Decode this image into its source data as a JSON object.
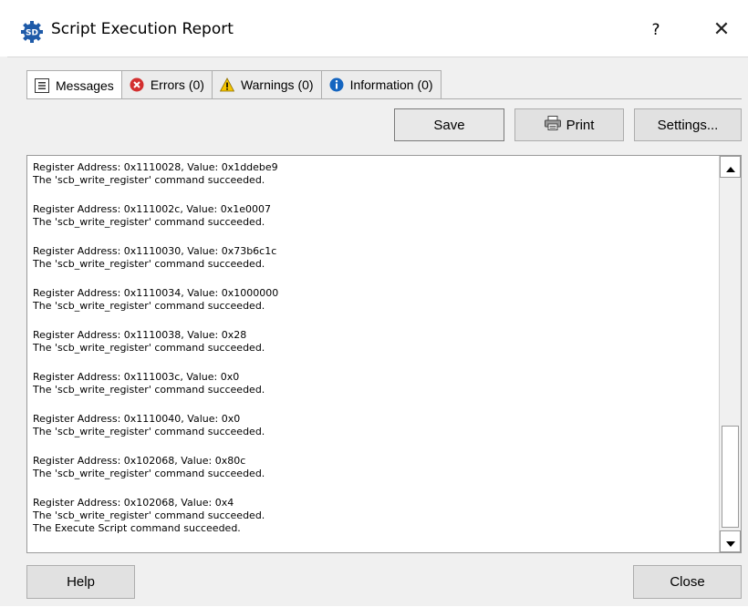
{
  "window": {
    "title": "Script Execution Report",
    "help_glyph": "?",
    "close_glyph": "✕",
    "app_icon": "sd-gear-icon",
    "app_icon_text": "SD"
  },
  "tabs": [
    {
      "label": "Messages",
      "icon": "list-icon",
      "active": true
    },
    {
      "label": "Errors (0)",
      "icon": "error-icon",
      "active": false
    },
    {
      "label": "Warnings (0)",
      "icon": "warning-icon",
      "active": false
    },
    {
      "label": "Information (0)",
      "icon": "info-icon",
      "active": false
    }
  ],
  "toolbar": {
    "save_label": "Save",
    "print_label": "Print",
    "print_icon": "printer-icon",
    "settings_label": "Settings..."
  },
  "log": [
    [
      "Register Address: 0x1110028, Value: 0x1ddebe9",
      "The 'scb_write_register' command succeeded."
    ],
    [
      "Register Address: 0x111002c, Value: 0x1e0007",
      "The 'scb_write_register' command succeeded."
    ],
    [
      "Register Address: 0x1110030, Value: 0x73b6c1c",
      "The 'scb_write_register' command succeeded."
    ],
    [
      "Register Address: 0x1110034, Value: 0x1000000",
      "The 'scb_write_register' command succeeded."
    ],
    [
      "Register Address: 0x1110038, Value: 0x28",
      "The 'scb_write_register' command succeeded."
    ],
    [
      "Register Address: 0x111003c, Value: 0x0",
      "The 'scb_write_register' command succeeded."
    ],
    [
      "Register Address: 0x1110040, Value: 0x0",
      "The 'scb_write_register' command succeeded."
    ],
    [
      "Register Address: 0x102068, Value: 0x80c",
      "The 'scb_write_register' command succeeded."
    ],
    [
      "Register Address: 0x102068, Value: 0x4",
      "The 'scb_write_register' command succeeded.",
      "The Execute Script command succeeded."
    ]
  ],
  "footer": {
    "help_label": "Help",
    "close_label": "Close"
  },
  "colors": {
    "error": "#d32f2f",
    "warning": "#f5c400",
    "info": "#1565c0",
    "app_icon": "#1e5aa8"
  }
}
